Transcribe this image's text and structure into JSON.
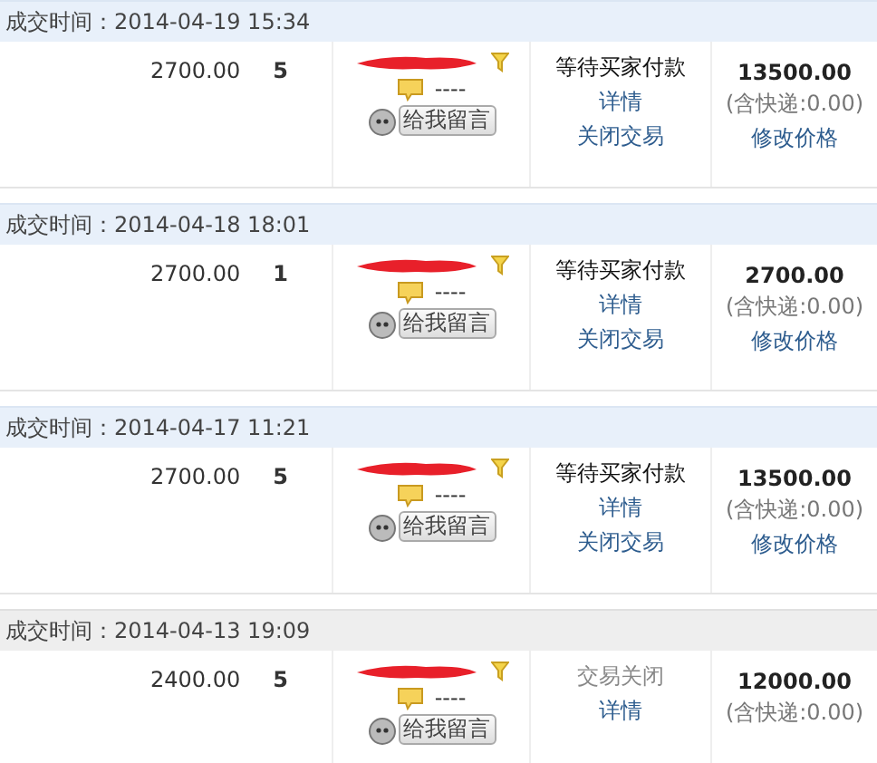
{
  "orders": [
    {
      "time_label": "成交时间：2014-04-19 15:34",
      "closed": false,
      "price": "2700.00",
      "quantity": "5",
      "remark": "----",
      "message_button": "给我留言",
      "status": "等待买家付款",
      "actions": [
        "详情",
        "关闭交易"
      ],
      "total": "13500.00",
      "shipping": "(含快递:0.00)",
      "modify": "修改价格"
    },
    {
      "time_label": "成交时间：2014-04-18 18:01",
      "closed": false,
      "price": "2700.00",
      "quantity": "1",
      "remark": "----",
      "message_button": "给我留言",
      "status": "等待买家付款",
      "actions": [
        "详情",
        "关闭交易"
      ],
      "total": "2700.00",
      "shipping": "(含快递:0.00)",
      "modify": "修改价格"
    },
    {
      "time_label": "成交时间：2014-04-17 11:21",
      "closed": false,
      "price": "2700.00",
      "quantity": "5",
      "remark": "----",
      "message_button": "给我留言",
      "status": "等待买家付款",
      "actions": [
        "详情",
        "关闭交易"
      ],
      "total": "13500.00",
      "shipping": "(含快递:0.00)",
      "modify": "修改价格"
    },
    {
      "time_label": "成交时间：2014-04-13 19:09",
      "closed": true,
      "price": "2400.00",
      "quantity": "5",
      "remark": "----",
      "message_button": "给我留言",
      "status": "交易关闭",
      "actions": [
        "详情"
      ],
      "total": "12000.00",
      "shipping": "(含快递:0.00)"
    }
  ]
}
